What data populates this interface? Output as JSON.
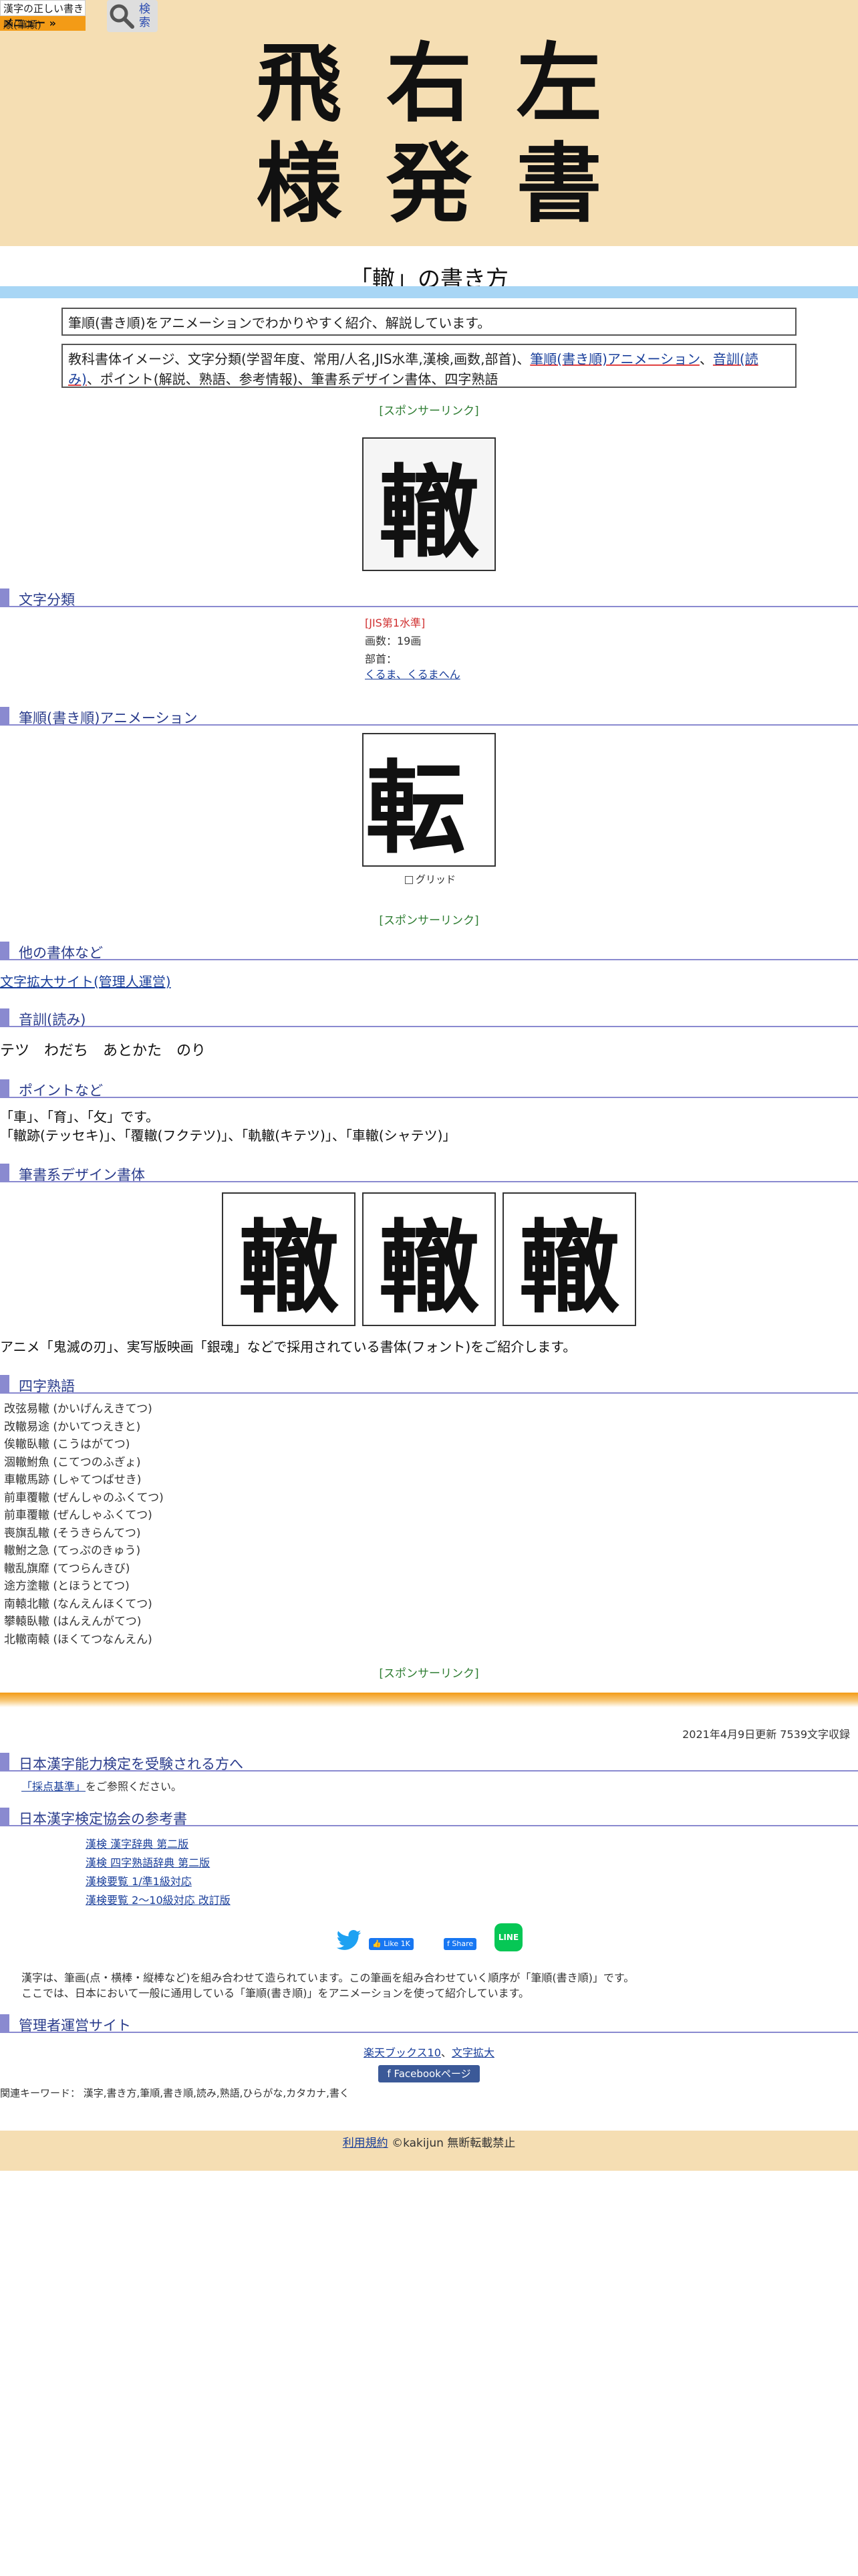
{
  "header": {
    "logo_text": "漢字の正しい書き順(筆順)",
    "menu_label": "メニュー »",
    "search_label": "検索"
  },
  "hero": {
    "chars": [
      "飛",
      "右",
      "左",
      "様",
      "発",
      "書"
    ]
  },
  "page_title": "「轍」の書き方",
  "intro": "筆順(書き順)をアニメーションでわかりやすく紹介、解説しています。",
  "summary": {
    "prefix": "教科書体イメージ、文字分類(学習年度、常用/人名,JIS水準,漢検,画数,部首)、",
    "link1": "筆順(書き順)アニメーション",
    "sep": "、",
    "link2": "音訓(読み)",
    "suffix": "、ポイント(解説、熟語、参考情報)、筆書系デザイン書体、四字熟語"
  },
  "sponsor_label": "[スポンサーリンク]",
  "main_kanji": "轍",
  "sections": {
    "classification": "文字分類",
    "animation": "筆順(書き順)アニメーション",
    "other_fonts": "他の書体など",
    "reading": "音訓(読み)",
    "points": "ポイントなど",
    "design_font": "筆書系デザイン書体",
    "yoji": "四字熟語",
    "kanken": "日本漢字能力検定を受験される方へ",
    "reference": "日本漢字検定協会の参考書",
    "admin": "管理者運営サイト"
  },
  "classification": {
    "jis": "[JIS第1水準]",
    "strokes": "画数：19画",
    "radical_label": "部首：",
    "radical_link": "くるま、くるまへん"
  },
  "animation": {
    "frame_char": "転",
    "grid_label": "グリッド"
  },
  "other_fonts_link": "文字拡大サイト(管理人運営)",
  "reading": "テツ　わだち　あとかた　のり",
  "points": {
    "line1": "「車」、「育」、「攵」です。",
    "line2": "「轍跡(テッセキ)」、「覆轍(フクテツ)」、「軌轍(キテツ)」、「車轍(シャテツ)」"
  },
  "design_font": {
    "samples": [
      "轍",
      "轍",
      "轍"
    ],
    "note": "アニメ「鬼滅の刃」、実写版映画「銀魂」などで採用されている書体(フォント)をご紹介します。"
  },
  "yoji_list": [
    "改弦易轍 (かいげんえきてつ)",
    "改轍易途 (かいてつえきと)",
    "俟轍臥轍 (こうはがてつ)",
    "涸轍鮒魚 (こてつのふぎょ)",
    "車轍馬跡 (しゃてつばせき)",
    "前車覆轍 (ぜんしゃのふくてつ)",
    "前車覆轍 (ぜんしゃふくてつ)",
    "喪旗乱轍 (そうきらんてつ)",
    "轍鮒之急 (てっぷのきゅう)",
    "轍乱旗靡 (てつらんきび)",
    "途方塗轍 (とほうとてつ)",
    "南轅北轍 (なんえんほくてつ)",
    "攀轅臥轍 (はんえんがてつ)",
    "北轍南轅 (ほくてつなんえん)"
  ],
  "updated": "2021年4月9日更新 7539文字収録",
  "kanken": {
    "link": "「採点基準」",
    "suffix": "をご参照ください。"
  },
  "reference_links": [
    "漢検 漢字辞典 第二版",
    "漢検 四字熟語辞典 第二版",
    "漢検要覧 1/準1級対応",
    "漢検要覧 2～10級対応 改訂版"
  ],
  "share": {
    "like": "Like 1K",
    "share": "Share",
    "line": "LINE"
  },
  "description": {
    "line1": "漢字は、筆画(点・横棒・縦棒など)を組み合わせて造られています。この筆画を組み合わせていく順序が「筆順(書き順)」です。",
    "line2": "ここでは、日本において一般に通用している「筆順(書き順)」をアニメーションを使って紹介しています。"
  },
  "admin": {
    "link1": "楽天ブックス10",
    "sep": "、",
    "link2": "文字拡大",
    "fb_page": "Facebookページ"
  },
  "keywords": "関連キーワード： 漢字,書き方,筆順,書き順,読み,熟語,ひらがな,カタカナ,書く",
  "footer": {
    "terms": "利用規約",
    "copyright": "©kakijun 無断転載禁止"
  }
}
